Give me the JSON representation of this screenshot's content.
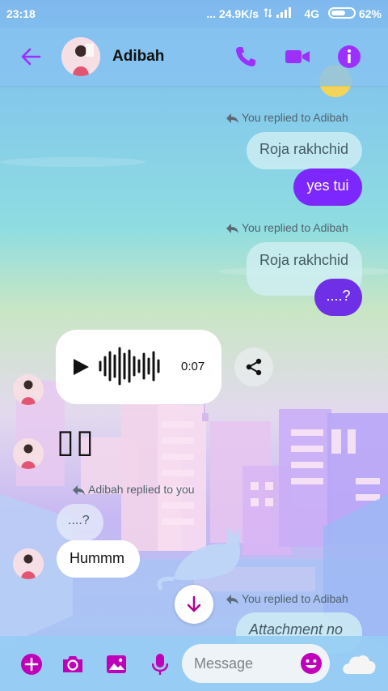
{
  "status_bar": {
    "time": "23:18",
    "network_speed": "... 24.9K/s",
    "network_type": "4G",
    "battery": "62%"
  },
  "header": {
    "contact_name": "Adibah",
    "icons": [
      "back-arrow-icon",
      "phone-icon",
      "video-camera-icon",
      "info-icon"
    ],
    "accent_color": "#9b30ff"
  },
  "messages": [
    {
      "type": "reply_note",
      "text": "You replied to Adibah"
    },
    {
      "type": "quoted",
      "text": "Roja rakhchid"
    },
    {
      "type": "outgoing",
      "text": "yes tui"
    },
    {
      "type": "reply_note",
      "text": "You replied to Adibah"
    },
    {
      "type": "quoted",
      "text": "Roja rakhchid"
    },
    {
      "type": "outgoing",
      "text": "....?"
    },
    {
      "type": "incoming_audio",
      "duration": "0:07"
    },
    {
      "type": "incoming_glyphs",
      "text": "▯▯"
    },
    {
      "type": "reply_note",
      "text": "Adibah replied to you"
    },
    {
      "type": "quoted",
      "text": "....?"
    },
    {
      "type": "incoming",
      "text": "Hummm"
    },
    {
      "type": "reply_note",
      "text": "You replied to Adibah"
    },
    {
      "type": "quoted",
      "text": "Attachment no"
    }
  ],
  "composer": {
    "placeholder": "Message",
    "icons": [
      "plus-icon",
      "camera-icon",
      "gallery-icon",
      "microphone-icon",
      "emoji-icon",
      "cloud-icon"
    ]
  },
  "colors": {
    "outgoing_bubble": "#7d27ff",
    "icon_purple": "#9b30ff",
    "composer_icon_magenta": "#c000b8"
  }
}
